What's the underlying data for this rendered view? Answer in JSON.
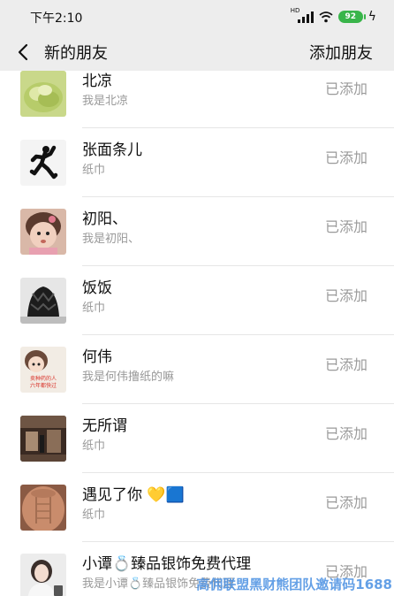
{
  "status_bar": {
    "time": "下午2:10",
    "battery": "92"
  },
  "nav": {
    "title": "新的朋友",
    "action": "添加朋友"
  },
  "friends": [
    {
      "name": "北凉",
      "sub": "我是北凉",
      "status": "已添加"
    },
    {
      "name": "张面条儿",
      "sub": "纸巾",
      "status": "已添加"
    },
    {
      "name": "初阳、",
      "sub": "我是初阳、",
      "status": "已添加"
    },
    {
      "name": "饭饭",
      "sub": "纸巾",
      "status": "已添加"
    },
    {
      "name": "何伟",
      "sub": "我是何伟撸纸的嘛",
      "status": "已添加"
    },
    {
      "name": "无所谓",
      "sub": "纸巾",
      "status": "已添加"
    },
    {
      "name": "遇见了你 💛🟦",
      "sub": "纸巾",
      "status": "已添加"
    },
    {
      "name": "小谭💍臻品银饰免费代理",
      "sub": "我是小谭💍臻品银饰免费代理",
      "status": "已添加"
    }
  ],
  "avatar_text": {
    "heweiline1": "卖种药的人",
    "heweiline2": "六年都快过"
  },
  "watermark": "高佣联盟黑财熊团队邀请码1688"
}
